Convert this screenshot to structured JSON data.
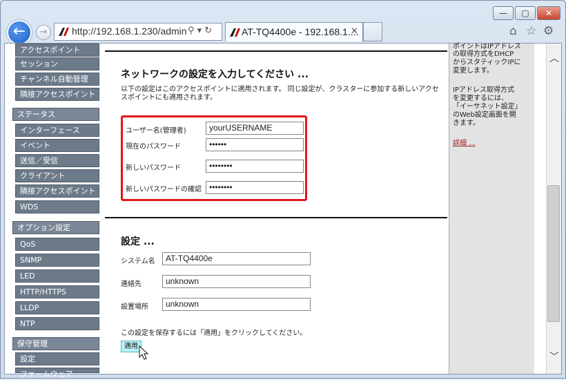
{
  "window": {
    "minimize": "—",
    "restore": "▢",
    "close": "✕"
  },
  "nav": {
    "back_icon": "←",
    "forward_icon": "→"
  },
  "address": {
    "url": "http://192.168.1.230/admin",
    "icons": "⚲ ▾ ↻"
  },
  "tab": {
    "title": "AT-TQ4400e - 192.168.1....",
    "close": "✕"
  },
  "toolbar": {
    "home": "⌂",
    "favorites": "☆",
    "settings": "⚙"
  },
  "sidebar": {
    "items": [
      {
        "label": "アクセスポイント",
        "type": "sub"
      },
      {
        "label": "セッション",
        "type": "sub"
      },
      {
        "label": "チャンネル自動管理",
        "type": "sub"
      },
      {
        "label": "隣接アクセスポイント",
        "type": "sub"
      },
      {
        "label": "ステータス",
        "type": "hdr"
      },
      {
        "label": "インターフェース",
        "type": "sub"
      },
      {
        "label": "イベント",
        "type": "sub"
      },
      {
        "label": "送信／受信",
        "type": "sub"
      },
      {
        "label": "クライアント",
        "type": "sub"
      },
      {
        "label": "隣接アクセスポイント",
        "type": "sub"
      },
      {
        "label": "WDS",
        "type": "sub"
      },
      {
        "label": "オプション設定",
        "type": "hdr"
      },
      {
        "label": "QoS",
        "type": "sub"
      },
      {
        "label": "SNMP",
        "type": "sub"
      },
      {
        "label": "LED",
        "type": "sub"
      },
      {
        "label": "HTTP/HTTPS",
        "type": "sub"
      },
      {
        "label": "LLDP",
        "type": "sub"
      },
      {
        "label": "NTP",
        "type": "sub"
      },
      {
        "label": "保守管理",
        "type": "hdr"
      },
      {
        "label": "設定",
        "type": "sub"
      },
      {
        "label": "ファームウェア",
        "type": "sub"
      }
    ]
  },
  "network": {
    "title": "ネットワークの設定を入力してください ...",
    "desc_line1": "以下の設定はこのアクセスポイントに適用されます。 同じ設定が、クラスターに参加する新しいアクセ",
    "desc_line2": "スポイントにも適用されます。",
    "username_label": "ユーザー名(管理者)",
    "username_value": "yourUSERNAME",
    "current_pw_label": "現在のパスワード",
    "current_pw_value": "••••••",
    "new_pw_label": "新しいパスワード",
    "new_pw_value": "••••••••",
    "confirm_pw_label": "新しいパスワードの確認",
    "confirm_pw_value": "••••••••"
  },
  "settings": {
    "title": "設定 ...",
    "system_name_label": "システム名",
    "system_name_value": "AT-TQ4400e",
    "contact_label": "連絡先",
    "contact_value": "unknown",
    "location_label": "設置場所",
    "location_value": "unknown",
    "save_hint": "この設定を保存するには「適用」をクリックしてください。",
    "apply_label": "適用"
  },
  "help": {
    "line1": "ポイントはIPアドレス",
    "line2": "の取得方式をDHCP",
    "line3": "からスタティックIPに",
    "line4": "変更します。",
    "line5": "IPアドレス取得方式",
    "line6": "を変更するには、",
    "line7": "「イーサネット設定」",
    "line8": "のWeb設定画面を開",
    "line9": "きます。",
    "more": "詳細 ..."
  },
  "scrollbar": {
    "up": "︿",
    "down": "﹀"
  }
}
